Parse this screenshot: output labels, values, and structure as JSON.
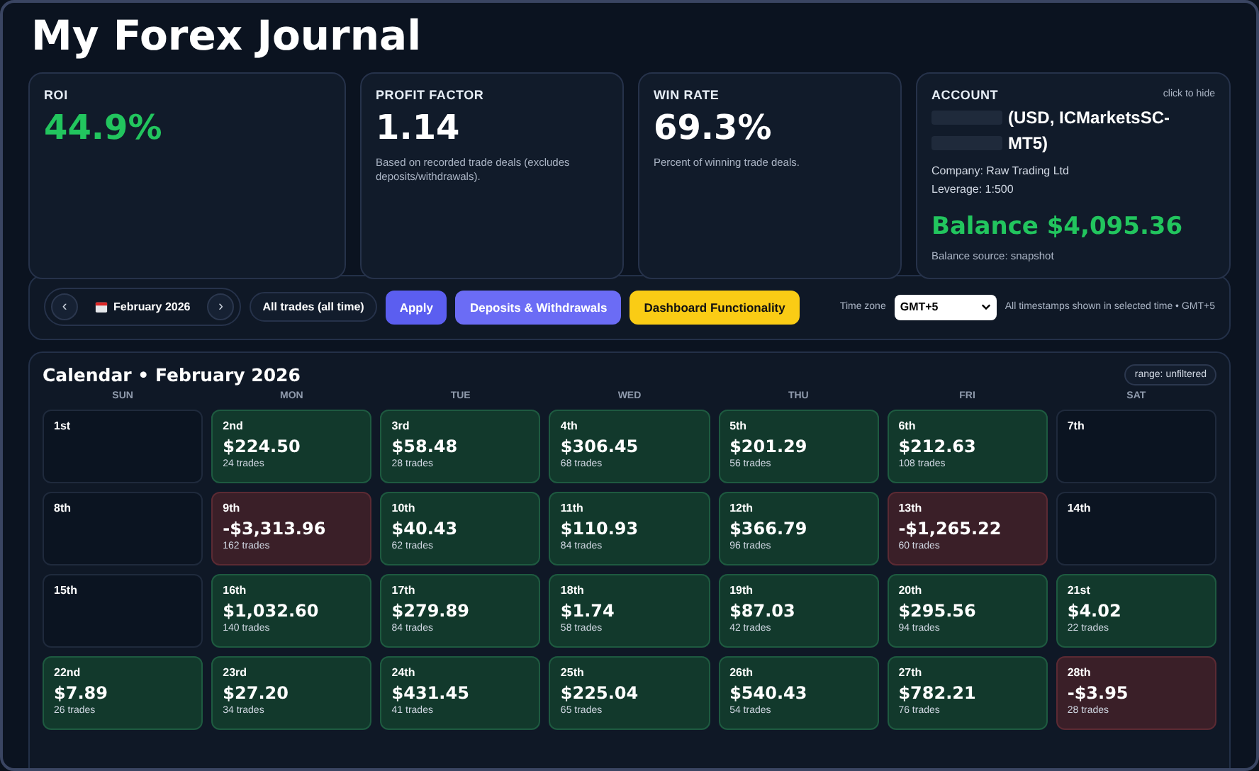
{
  "title": "My Forex Journal",
  "cards": [
    {
      "kind": "stat",
      "label": "ROI",
      "value": "44.9%",
      "color": "#22c55e"
    },
    {
      "kind": "stat",
      "label": "PROFIT FACTOR",
      "value": "1.14",
      "color": "#ffffff",
      "note": "Based on recorded trade deals (excludes deposits/withdrawals)."
    },
    {
      "kind": "stat",
      "label": "WIN RATE",
      "value": "69.3%",
      "color": "#ffffff",
      "note": "Percent of winning trade deals."
    },
    {
      "kind": "account",
      "label": "ACCOUNT",
      "hide_link": "click to hide",
      "name_lines": [
        "(USD, ICMarketsSC-",
        "MT5)"
      ],
      "company": "Company: Raw Trading Ltd",
      "leverage": "Leverage: 1:500",
      "balance": "Balance $4,095.36",
      "source": "Balance source: snapshot"
    }
  ],
  "toolbar": {
    "prev": "‹",
    "month": "February 2026",
    "next": "›",
    "filter": "All trades (all time)",
    "buttons": [
      {
        "label": "Apply",
        "kind": "primary"
      },
      {
        "label": "Deposits & Withdrawals",
        "kind": "secondary"
      },
      {
        "label": "Dashboard Functionality",
        "kind": "accent"
      }
    ],
    "timezone_label": "Time zone",
    "timezone": "GMT+5",
    "timezone_note": "All timestamps shown in selected time • GMT+5"
  },
  "calendar": {
    "title": "Calendar • February 2026",
    "range": "range: unfiltered",
    "weekdays": [
      "SUN",
      "MON",
      "TUE",
      "WED",
      "THU",
      "FRI",
      "SAT"
    ],
    "days": [
      {
        "day": "1st",
        "kind": "none"
      },
      {
        "day": "2nd",
        "kind": "gain",
        "pnl": "$224.50",
        "trades": "24 trades"
      },
      {
        "day": "3rd",
        "kind": "gain",
        "pnl": "$58.48",
        "trades": "28 trades"
      },
      {
        "day": "4th",
        "kind": "gain",
        "pnl": "$306.45",
        "trades": "68 trades"
      },
      {
        "day": "5th",
        "kind": "gain",
        "pnl": "$201.29",
        "trades": "56 trades"
      },
      {
        "day": "6th",
        "kind": "gain",
        "pnl": "$212.63",
        "trades": "108 trades"
      },
      {
        "day": "7th",
        "kind": "none"
      },
      {
        "day": "8th",
        "kind": "none"
      },
      {
        "day": "9th",
        "kind": "loss",
        "pnl": "-$3,313.96",
        "trades": "162 trades"
      },
      {
        "day": "10th",
        "kind": "gain",
        "pnl": "$40.43",
        "trades": "62 trades"
      },
      {
        "day": "11th",
        "kind": "gain",
        "pnl": "$110.93",
        "trades": "84 trades"
      },
      {
        "day": "12th",
        "kind": "gain",
        "pnl": "$366.79",
        "trades": "96 trades"
      },
      {
        "day": "13th",
        "kind": "loss",
        "pnl": "-$1,265.22",
        "trades": "60 trades"
      },
      {
        "day": "14th",
        "kind": "none"
      },
      {
        "day": "15th",
        "kind": "none"
      },
      {
        "day": "16th",
        "kind": "gain",
        "pnl": "$1,032.60",
        "trades": "140 trades"
      },
      {
        "day": "17th",
        "kind": "gain",
        "pnl": "$279.89",
        "trades": "84 trades"
      },
      {
        "day": "18th",
        "kind": "gain",
        "pnl": "$1.74",
        "trades": "58 trades"
      },
      {
        "day": "19th",
        "kind": "gain",
        "pnl": "$87.03",
        "trades": "42 trades"
      },
      {
        "day": "20th",
        "kind": "gain",
        "pnl": "$295.56",
        "trades": "94 trades"
      },
      {
        "day": "21st",
        "kind": "gain",
        "pnl": "$4.02",
        "trades": "22 trades"
      },
      {
        "day": "22nd",
        "kind": "gain",
        "pnl": "$7.89",
        "trades": "26 trades"
      },
      {
        "day": "23rd",
        "kind": "gain",
        "pnl": "$27.20",
        "trades": "34 trades"
      },
      {
        "day": "24th",
        "kind": "gain",
        "pnl": "$431.45",
        "trades": "41 trades"
      },
      {
        "day": "25th",
        "kind": "gain",
        "pnl": "$225.04",
        "trades": "65 trades"
      },
      {
        "day": "26th",
        "kind": "gain",
        "pnl": "$540.43",
        "trades": "54 trades"
      },
      {
        "day": "27th",
        "kind": "gain",
        "pnl": "$782.21",
        "trades": "76 trades"
      },
      {
        "day": "28th",
        "kind": "loss",
        "pnl": "-$3.95",
        "trades": "28 trades"
      }
    ]
  }
}
